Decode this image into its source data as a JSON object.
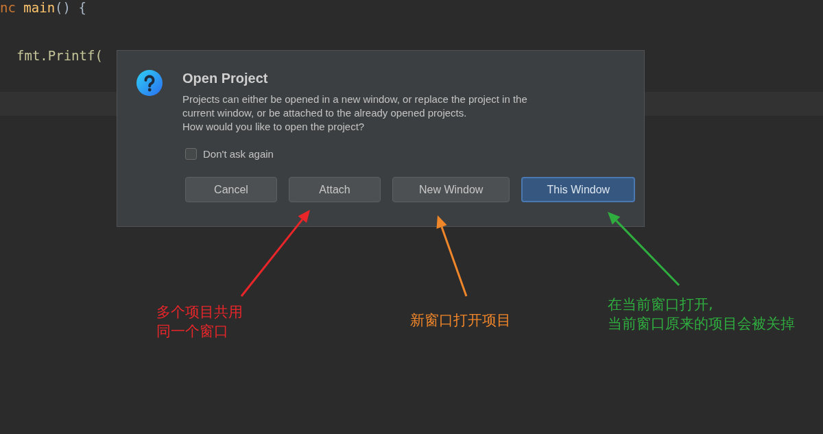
{
  "editor": {
    "lines": [
      {
        "tokens": [
          {
            "kind": "keyword",
            "text": "nc"
          },
          {
            "kind": "function",
            "text": " main"
          },
          {
            "kind": "plain",
            "text": "() {"
          }
        ],
        "children": [
          {
            "tokens": [
              {
                "kind": "call",
                "text": "fmt.Printf("
              }
            ]
          }
        ]
      }
    ]
  },
  "dialog": {
    "title": "Open Project",
    "message_lines": [
      "Projects can either be opened in a new window, or replace the project in the",
      "current window, or be attached to the already opened projects.",
      "How would you like to open the project?"
    ],
    "checkbox": {
      "label": "Don't ask again",
      "checked": false
    },
    "buttons": [
      {
        "label": "Cancel",
        "default": false
      },
      {
        "label": "Attach",
        "default": false
      },
      {
        "label": "New Window",
        "default": false
      },
      {
        "label": "This Window",
        "default": true
      }
    ]
  },
  "annotations": [
    {
      "color": "#e8262a",
      "lines": [
        "多个项目共用",
        "同一个窗口"
      ]
    },
    {
      "color": "#f0862a",
      "lines": [
        "新窗口打开项目"
      ]
    },
    {
      "color": "#2fae3f",
      "lines": [
        "在当前窗口打开,",
        "当前窗口原来的项目会被关掉"
      ]
    }
  ]
}
